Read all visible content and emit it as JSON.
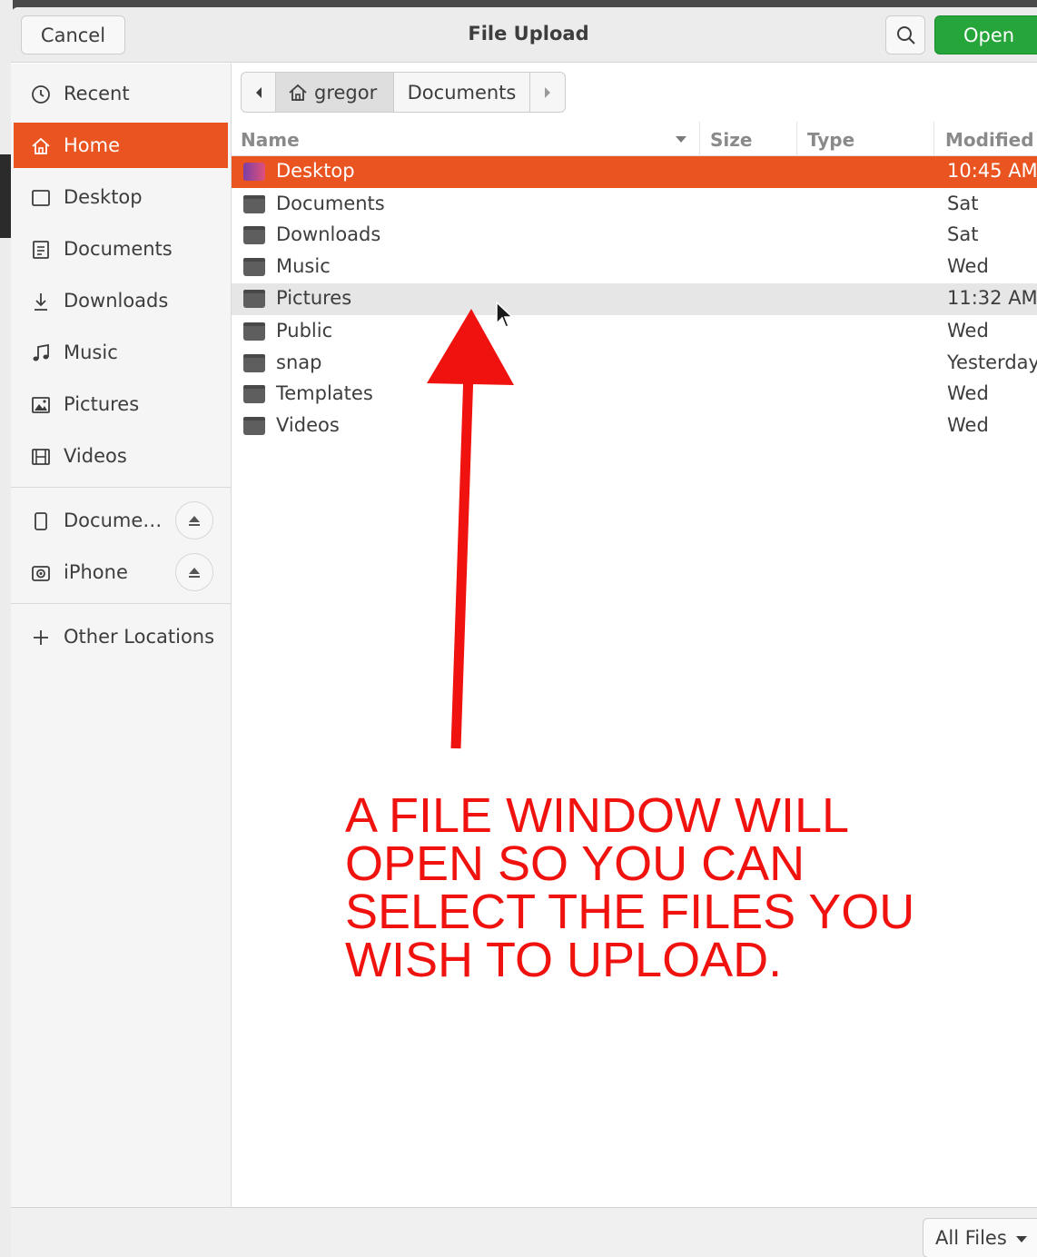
{
  "window": {
    "title": "File Upload",
    "cancel_label": "Cancel",
    "open_label": "Open"
  },
  "sidebar": {
    "items": [
      {
        "label": "Recent",
        "icon": "clock-icon"
      },
      {
        "label": "Home",
        "icon": "home-icon",
        "active": true
      },
      {
        "label": "Desktop",
        "icon": "desktop-icon"
      },
      {
        "label": "Documents",
        "icon": "document-icon"
      },
      {
        "label": "Downloads",
        "icon": "download-icon"
      },
      {
        "label": "Music",
        "icon": "music-note-icon"
      },
      {
        "label": "Pictures",
        "icon": "picture-icon"
      },
      {
        "label": "Videos",
        "icon": "film-icon"
      }
    ],
    "devices": [
      {
        "label": "Docume…",
        "icon": "phone-icon",
        "eject": true
      },
      {
        "label": "iPhone",
        "icon": "camera-icon",
        "eject": true
      }
    ],
    "other_locations": "Other Locations"
  },
  "pathbar": {
    "segments": [
      "gregor",
      "Documents"
    ]
  },
  "columns": {
    "name": "Name",
    "size": "Size",
    "type": "Type",
    "modified": "Modified"
  },
  "files": [
    {
      "name": "Desktop",
      "modified": "10:45 AM",
      "selected": true
    },
    {
      "name": "Documents",
      "modified": "Sat"
    },
    {
      "name": "Downloads",
      "modified": "Sat"
    },
    {
      "name": "Music",
      "modified": "Wed"
    },
    {
      "name": "Pictures",
      "modified": "11:32 AM",
      "hover": true
    },
    {
      "name": "Public",
      "modified": "Wed"
    },
    {
      "name": "snap",
      "modified": "Yesterday"
    },
    {
      "name": "Templates",
      "modified": "Wed"
    },
    {
      "name": "Videos",
      "modified": "Wed"
    }
  ],
  "footer": {
    "filter_label": "All Files"
  },
  "annotation": {
    "text": "A FILE WINDOW WILL\nOPEN SO YOU CAN\nSELECT THE FILES YOU\nWISH TO UPLOAD.",
    "color": "#f0120e"
  },
  "colors": {
    "accent": "#e95420",
    "open_button": "#26a63a"
  }
}
